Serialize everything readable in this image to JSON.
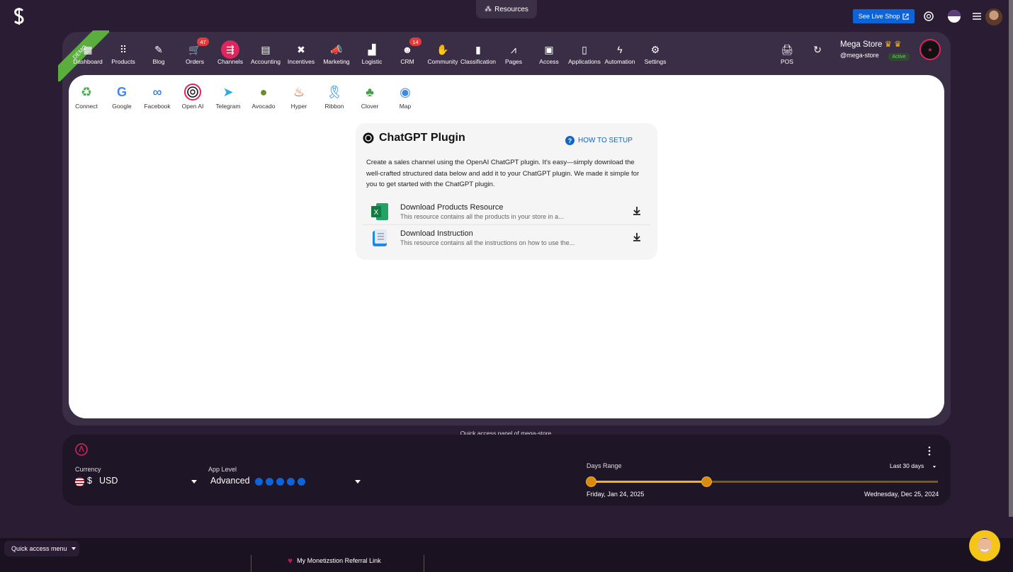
{
  "topbar": {
    "resources_label": "Resources",
    "live_shop_label": "See Live Shop"
  },
  "nav": {
    "demo_label": "DEMO",
    "items": [
      {
        "label": "Dashboard"
      },
      {
        "label": "Products"
      },
      {
        "label": "Blog"
      },
      {
        "label": "Orders",
        "badge": "47"
      },
      {
        "label": "Channels"
      },
      {
        "label": "Accounting"
      },
      {
        "label": "Incentives"
      },
      {
        "label": "Marketing"
      },
      {
        "label": "Logistic"
      },
      {
        "label": "CRM",
        "badge": "14"
      },
      {
        "label": "Community"
      },
      {
        "label": "Classification"
      },
      {
        "label": "Pages"
      },
      {
        "label": "Access"
      },
      {
        "label": "Applications"
      },
      {
        "label": "Automation"
      },
      {
        "label": "Settings"
      },
      {
        "label": "POS"
      }
    ],
    "active": "Channels"
  },
  "store": {
    "name": "Mega Store",
    "handle": "@mega-store",
    "status": "Active"
  },
  "channels": {
    "items": [
      {
        "label": "Connect"
      },
      {
        "label": "Google"
      },
      {
        "label": "Facebook"
      },
      {
        "label": "Open AI"
      },
      {
        "label": "Telegram"
      },
      {
        "label": "Avocado"
      },
      {
        "label": "Hyper"
      },
      {
        "label": "Ribbon"
      },
      {
        "label": "Clover"
      },
      {
        "label": "Map"
      }
    ],
    "selected": "Open AI"
  },
  "plugin_card": {
    "title": "ChatGPT Plugin",
    "howto_label": "HOW TO SETUP",
    "description": "Create a sales channel using the OpenAI ChatGPT plugin. It's easy—simply download the well-crafted structured data below and add it to your ChatGPT plugin. We made it simple for you to get started with the ChatGPT plugin.",
    "resources": [
      {
        "title": "Download Products Resource",
        "subtitle": "This resource contains all the products in your store in a..."
      },
      {
        "title": "Download Instruction",
        "subtitle": "This resource contains all the instructions on how to use the..."
      }
    ]
  },
  "quick_access": {
    "tab_label": "Quick access panel of mega-store",
    "currency_label": "Currency",
    "currency_symbol": "$",
    "currency_value": "USD",
    "app_level_label": "App Level",
    "app_level_value": "Advanced",
    "app_level_dots": 5,
    "days_range_label": "Days Range",
    "days_range_value": "Last 30 days",
    "date_start": "Friday, Jan 24, 2025",
    "date_end": "Wednesday, Dec 25, 2024"
  },
  "bottom_bar": {
    "menu_label": "Quick access menu",
    "referral_label": "My Monetizstion Referral Link"
  }
}
